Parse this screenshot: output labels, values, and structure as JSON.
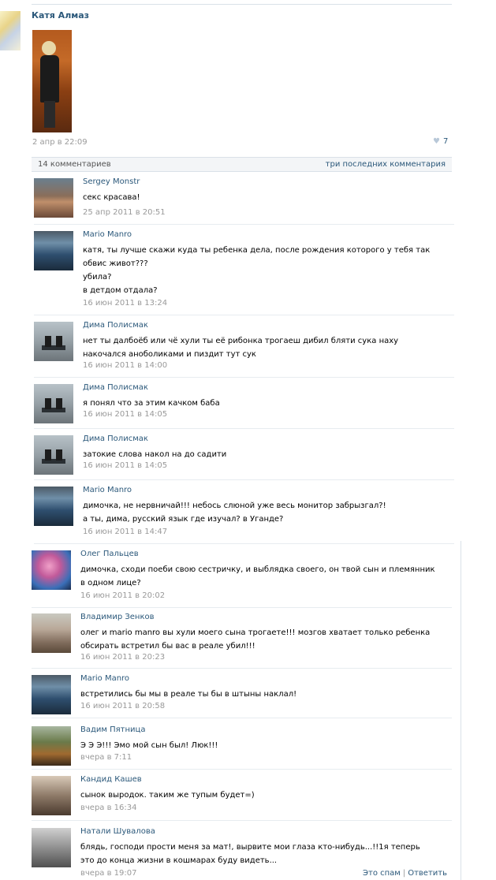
{
  "post": {
    "author": "Катя Алмаз",
    "time": "2 апр в 22:09",
    "likes": "7"
  },
  "comments_bar": {
    "count": "14 комментариев",
    "last": "три последних комментария"
  },
  "comments": [
    {
      "avatar": "man-avatar",
      "name": "Sergey Monstr",
      "text": "секс красава!",
      "time": "25 апр 2011 в 20:51"
    },
    {
      "avatar": "muscle-avatar",
      "name": "Mario Manro",
      "text": "катя, ты лучше скажи куда ты ребенка дела, после рождения которого у тебя так\nобвис живот???\nубила?\nв детдом отдала?",
      "time": "16 июн 2011 в 13:24"
    },
    {
      "avatar": "bench-avatar",
      "name": "Дима Полисмак",
      "text": "нет ты далбоёб или чё хули ты её рибонка трогаеш дибил бляти сука наху\nнакочался аноболиками и пиздит тут сук",
      "time": "16 июн 2011 в 14:00"
    },
    {
      "avatar": "bench-avatar",
      "name": "Дима Полисмак",
      "text": "я понял что за этим качком баба",
      "time": "16 июн 2011 в 14:05"
    },
    {
      "avatar": "bench-avatar",
      "name": "Дима Полисмак",
      "text": "затокие слова накол на до садити",
      "time": "16 июн 2011 в 14:05"
    },
    {
      "avatar": "muscle-avatar",
      "name": "Mario Manro",
      "text": "димочка, не нервничай!!! небось слюной уже весь монитор забрызгал?!\nа ты, дима, русский язык где изучал? в Уганде?",
      "time": "16 июн 2011 в 14:47"
    },
    {
      "avatar": "clown-avatar",
      "name": "Олег Пальцев",
      "text": "димочка, сходи поеби свою сестричку, и выблядка своего, он твой сын и племянник\nв одном лице?",
      "time": "16 июн 2011 в 20:02"
    },
    {
      "avatar": "boy-avatar",
      "name": "Владимир Зенков",
      "text": "олег и mario manro вы хули моего сына трогаете!!! мозгов хватает только ребенка\nобсирать встретил бы вас в реале убил!!!",
      "time": "16 июн 2011 в 20:23"
    },
    {
      "avatar": "muscle-avatar",
      "name": "Mario Manro",
      "text": "встретились бы мы в реале ты бы в штыны наклал!",
      "time": "16 июн 2011 в 20:58"
    },
    {
      "avatar": "guitar-avatar",
      "name": "Вадим Пятница",
      "text": "Э Э Э!!! Эмо мой сын был! Люк!!!",
      "time": "вчера в 7:11"
    },
    {
      "avatar": "group-avatar",
      "name": "Кандид Кашев",
      "text": "сынок выродок. таким же тупым будет=)",
      "time": "вчера в 16:34"
    },
    {
      "avatar": "statue-avatar",
      "name": "Натали Шувалова",
      "text": "блядь, господи прости меня за мат!, вырвите мои глаза кто-нибудь...!!1я теперь\nэто до конца жизни в кошмарах буду видеть...",
      "time": "вчера в 19:07",
      "spam": "Это спам",
      "reply": "Ответить"
    }
  ]
}
